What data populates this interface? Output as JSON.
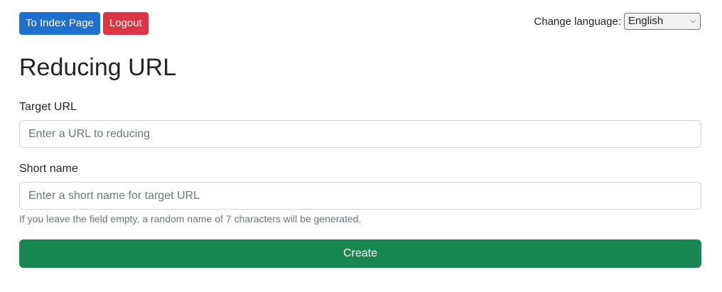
{
  "header": {
    "index_button_label": "To Index Page",
    "logout_button_label": "Logout",
    "language_label": "Change language:",
    "language_selected": "English"
  },
  "main": {
    "title": "Reducing URL",
    "target_url": {
      "label": "Target URL",
      "placeholder": "Enter a URL to reducing",
      "value": ""
    },
    "short_name": {
      "label": "Short name",
      "placeholder": "Enter a short name for target URL",
      "value": "",
      "help_text": "If you leave the field empty, a random name of 7 characters will be generated."
    },
    "create_button_label": "Create"
  },
  "colors": {
    "primary": "#1f6fcf",
    "danger": "#dc3545",
    "success": "#198754"
  }
}
